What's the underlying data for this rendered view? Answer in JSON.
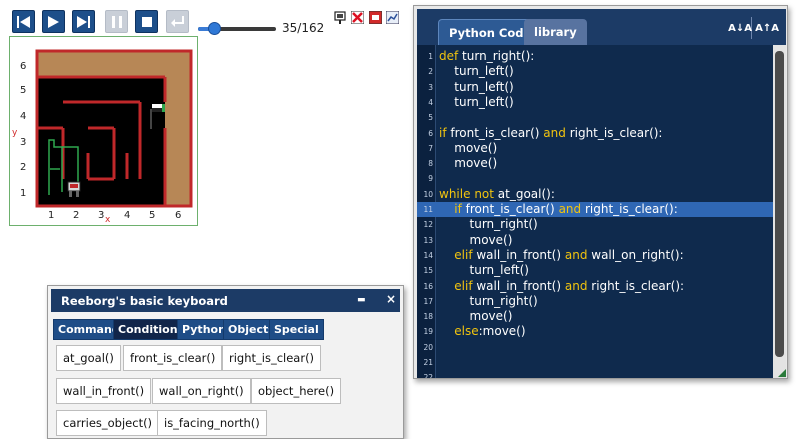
{
  "toolbar": {
    "step_counter": "35/162",
    "speed_slider_value": 0.2
  },
  "world": {
    "x_labels": [
      "1",
      "2",
      "3",
      "4",
      "5",
      "6"
    ],
    "y_labels": [
      "6",
      "5",
      "4",
      "3",
      "2",
      "1"
    ],
    "x_axis_label": "x",
    "y_axis_label": "y"
  },
  "code_editor": {
    "tabs": [
      "Python Code",
      "library"
    ],
    "font_decrease": "A↓A",
    "font_increase": "A↑A",
    "highlighted_line": 11,
    "lines": [
      {
        "n": "1",
        "segs": [
          {
            "t": "def",
            "kw": true
          },
          {
            "t": " turn_right():"
          }
        ]
      },
      {
        "n": "2",
        "segs": [
          {
            "t": "    turn_left()"
          }
        ]
      },
      {
        "n": "3",
        "segs": [
          {
            "t": "    turn_left()"
          }
        ]
      },
      {
        "n": "4",
        "segs": [
          {
            "t": "    turn_left()"
          }
        ]
      },
      {
        "n": "5",
        "segs": []
      },
      {
        "n": "6",
        "segs": [
          {
            "t": "if",
            "kw": true
          },
          {
            "t": " front_is_clear() "
          },
          {
            "t": "and",
            "kw": true
          },
          {
            "t": " right_is_clear():"
          }
        ]
      },
      {
        "n": "7",
        "segs": [
          {
            "t": "    move()"
          }
        ]
      },
      {
        "n": "8",
        "segs": [
          {
            "t": "    move()"
          }
        ]
      },
      {
        "n": "9",
        "segs": []
      },
      {
        "n": "10",
        "segs": [
          {
            "t": "while",
            "kw": true
          },
          {
            "t": " "
          },
          {
            "t": "not",
            "kw": true
          },
          {
            "t": " at_goal():"
          }
        ]
      },
      {
        "n": "11",
        "segs": [
          {
            "t": "    "
          },
          {
            "t": "if",
            "kw": true
          },
          {
            "t": " front_is_clear() "
          },
          {
            "t": "and",
            "kw": true
          },
          {
            "t": " right_is_clear():"
          }
        ]
      },
      {
        "n": "12",
        "segs": [
          {
            "t": "        turn_right()"
          }
        ]
      },
      {
        "n": "13",
        "segs": [
          {
            "t": "        move()"
          }
        ]
      },
      {
        "n": "14",
        "segs": [
          {
            "t": "    "
          },
          {
            "t": "elif",
            "kw": true
          },
          {
            "t": " wall_in_front() "
          },
          {
            "t": "and",
            "kw": true
          },
          {
            "t": " wall_on_right():"
          }
        ]
      },
      {
        "n": "15",
        "segs": [
          {
            "t": "        turn_left()"
          }
        ]
      },
      {
        "n": "16",
        "segs": [
          {
            "t": "    "
          },
          {
            "t": "elif",
            "kw": true
          },
          {
            "t": " wall_in_front() "
          },
          {
            "t": "and",
            "kw": true
          },
          {
            "t": " right_is_clear():"
          }
        ]
      },
      {
        "n": "17",
        "segs": [
          {
            "t": "        turn_right()"
          }
        ]
      },
      {
        "n": "18",
        "segs": [
          {
            "t": "        move()"
          }
        ]
      },
      {
        "n": "19",
        "segs": [
          {
            "t": "    "
          },
          {
            "t": "else",
            "kw": true
          },
          {
            "t": ":move()"
          }
        ]
      },
      {
        "n": "20",
        "segs": []
      },
      {
        "n": "21",
        "segs": []
      },
      {
        "n": "22",
        "segs": []
      }
    ]
  },
  "keyboard": {
    "title": "Reeborg's basic keyboard",
    "minimize": "▬",
    "close": "×",
    "tabs": [
      "Commands",
      "Conditions",
      "Python",
      "Objects",
      "Special"
    ],
    "active_tab": "Conditions",
    "keys": [
      [
        "at_goal()",
        "front_is_clear()",
        "right_is_clear()"
      ],
      [
        "wall_in_front()",
        "wall_on_right()",
        "object_here()"
      ],
      [
        "carries_object()",
        "is_facing_north()"
      ]
    ]
  },
  "colors": {
    "toolbar_button": "#1d4f8a",
    "editor_bg": "#0f2a4d",
    "keyword": "#f1c40f",
    "highlight": "#2f67b4",
    "wall": "#c0282a",
    "trace": "#2fa84f",
    "sand": "#b78756"
  },
  "icons": [
    "reload-icon",
    "step-back-icon",
    "run-icon",
    "step-forward-icon",
    "pause-icon",
    "stop-icon",
    "return-icon",
    "world-info-icon",
    "clear-world-icon",
    "clear-editor-icon",
    "edit-world-icon"
  ]
}
